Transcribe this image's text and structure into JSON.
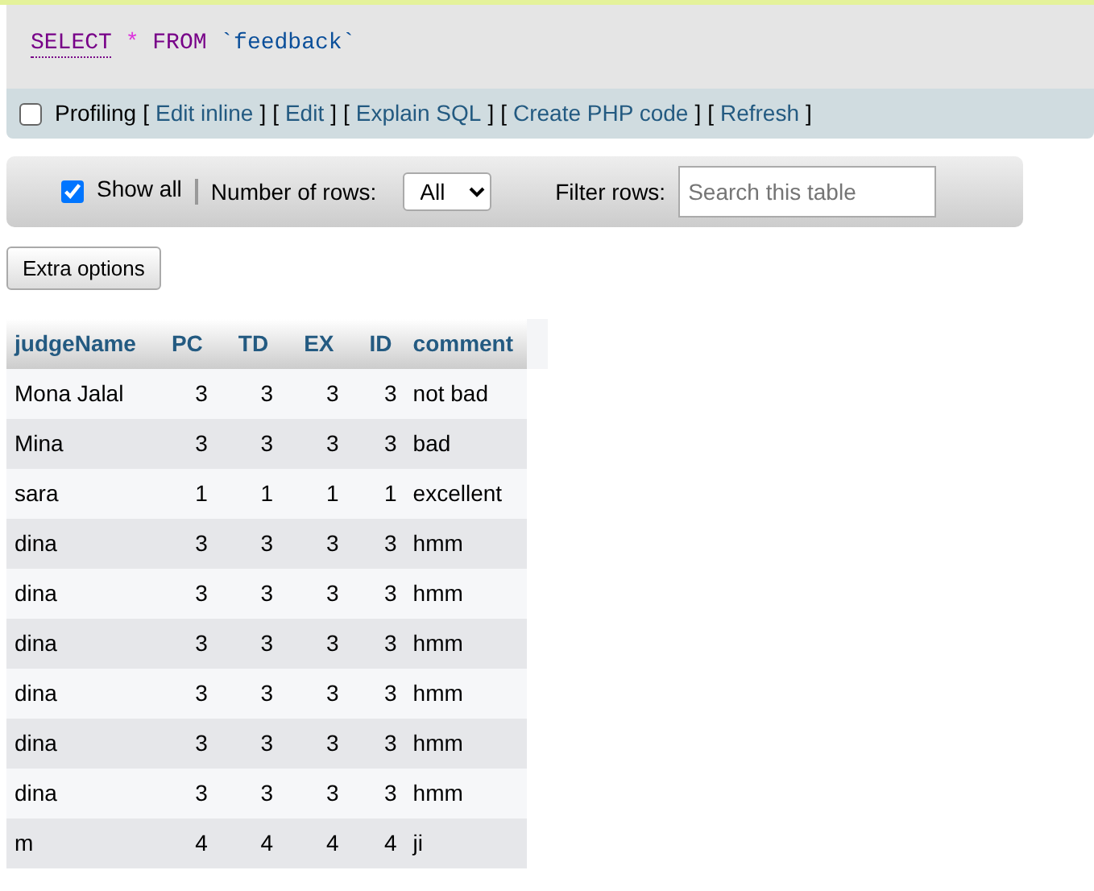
{
  "query": {
    "tokens": [
      {
        "kind": "keyword",
        "text": "SELECT",
        "underlined": true
      },
      {
        "kind": "operator",
        "text": "*"
      },
      {
        "kind": "keyword",
        "text": "FROM"
      },
      {
        "kind": "identifier",
        "text": "`feedback`"
      }
    ]
  },
  "profiling": {
    "checked": false,
    "label": "Profiling",
    "links": [
      {
        "open": "[",
        "text": "Edit inline",
        "close": "]"
      },
      {
        "open": "[",
        "text": "Edit",
        "close": "]"
      },
      {
        "open": "[",
        "text": "Explain SQL",
        "close": "]"
      },
      {
        "open": "[",
        "text": "Create PHP code",
        "close": "]"
      },
      {
        "open": "[",
        "text": "Refresh",
        "close": "]"
      }
    ]
  },
  "toolbar": {
    "show_all": {
      "label": "Show all",
      "checked": true
    },
    "rows_label": "Number of rows:",
    "rows_value": "All",
    "filter_label": "Filter rows:",
    "filter_placeholder": "Search this table"
  },
  "extra_button": "Extra options",
  "table": {
    "columns": [
      {
        "label": "judgeName",
        "kind": "text"
      },
      {
        "label": "PC",
        "kind": "number"
      },
      {
        "label": "TD",
        "kind": "number"
      },
      {
        "label": "EX",
        "kind": "number"
      },
      {
        "label": "ID",
        "kind": "number"
      },
      {
        "label": "comment",
        "kind": "text"
      }
    ],
    "rows": [
      [
        "Mona Jalal",
        "3",
        "3",
        "3",
        "3",
        "not bad"
      ],
      [
        "Mina",
        "3",
        "3",
        "3",
        "3",
        "bad"
      ],
      [
        "sara",
        "1",
        "1",
        "1",
        "1",
        "excellent"
      ],
      [
        "dina",
        "3",
        "3",
        "3",
        "3",
        "hmm"
      ],
      [
        "dina",
        "3",
        "3",
        "3",
        "3",
        "hmm"
      ],
      [
        "dina",
        "3",
        "3",
        "3",
        "3",
        "hmm"
      ],
      [
        "dina",
        "3",
        "3",
        "3",
        "3",
        "hmm"
      ],
      [
        "dina",
        "3",
        "3",
        "3",
        "3",
        "hmm"
      ],
      [
        "dina",
        "3",
        "3",
        "3",
        "3",
        "hmm"
      ],
      [
        "m",
        "4",
        "4",
        "4",
        "4",
        "ji"
      ]
    ]
  }
}
